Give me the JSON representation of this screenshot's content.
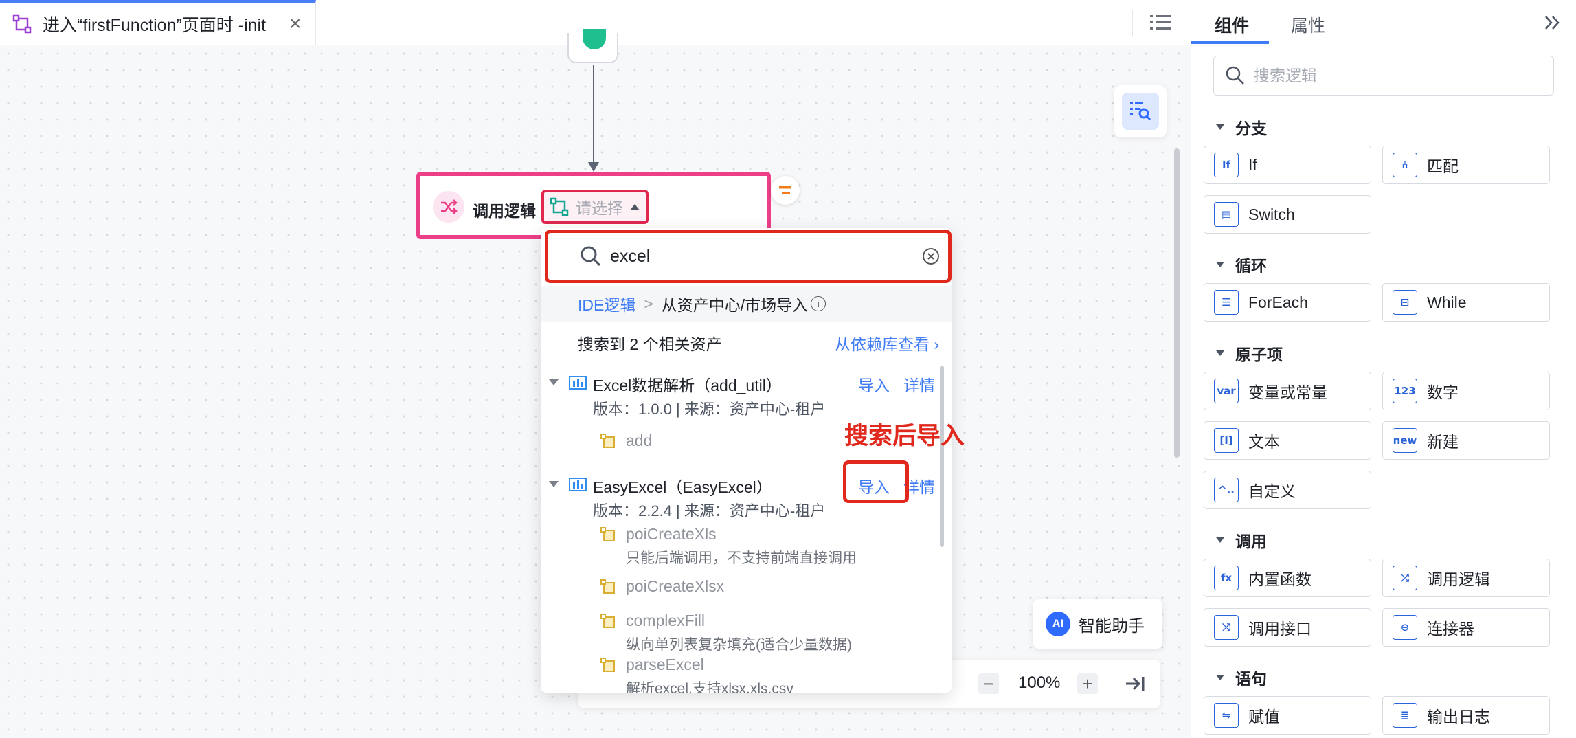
{
  "tab": {
    "title": "进入“firstFunction”页面时 -init",
    "close": "×"
  },
  "node": {
    "title": "调用逻辑",
    "select_placeholder": "请选择"
  },
  "dropdown": {
    "search_value": "excel",
    "breadcrumb": {
      "root": "IDE逻辑",
      "separator": ">",
      "current": "从资产中心/市场导入"
    },
    "result_count": "搜索到 2 个相关资产",
    "from_dependency": "从依赖库查看 ›",
    "assets": [
      {
        "name": "Excel数据解析（add_util）",
        "import": "导入",
        "detail": "详情",
        "meta": "版本：1.0.0  |  来源：资产中心-租户",
        "functions": [
          {
            "name": "add",
            "desc": ""
          }
        ]
      },
      {
        "name": "EasyExcel（EasyExcel）",
        "import": "导入",
        "detail": "详情",
        "meta": "版本：2.2.4  |  来源：资产中心-租户",
        "functions": [
          {
            "name": "poiCreateXls",
            "desc": "只能后端调用，不支持前端直接调用"
          },
          {
            "name": "poiCreateXlsx",
            "desc": ""
          },
          {
            "name": "complexFill",
            "desc": "纵向单列表复杂填充(适合少量数据)"
          },
          {
            "name": "parseExcel",
            "desc": "解析excel,支持xlsx,xls,csv"
          }
        ]
      }
    ]
  },
  "annotation": "搜索后导入",
  "toolbar": {
    "zoom": "100%",
    "minus": "−",
    "plus": "+"
  },
  "ai_assistant": {
    "badge": "AI",
    "label": "智能助手"
  },
  "panel": {
    "tabs": [
      "组件",
      "属性"
    ],
    "search_placeholder": "搜索逻辑",
    "sections": [
      {
        "title": "分支",
        "items": [
          {
            "label": "If",
            "icon": "If"
          },
          {
            "label": "匹配",
            "icon": "⑃"
          },
          {
            "label": "Switch",
            "icon": "▤"
          }
        ]
      },
      {
        "title": "循环",
        "items": [
          {
            "label": "ForEach",
            "icon": "☰"
          },
          {
            "label": "While",
            "icon": "⊟"
          }
        ]
      },
      {
        "title": "原子项",
        "items": [
          {
            "label": "变量或常量",
            "icon": "var"
          },
          {
            "label": "数字",
            "icon": "123"
          },
          {
            "label": "文本",
            "icon": "[I]"
          },
          {
            "label": "新建",
            "icon": "new"
          },
          {
            "label": "自定义",
            "icon": "^.."
          }
        ]
      },
      {
        "title": "调用",
        "items": [
          {
            "label": "内置函数",
            "icon": "fx"
          },
          {
            "label": "调用逻辑",
            "icon": "⤮"
          },
          {
            "label": "调用接口",
            "icon": "⤮"
          },
          {
            "label": "连接器",
            "icon": "⊖"
          }
        ]
      },
      {
        "title": "语句",
        "items": [
          {
            "label": "赋值",
            "icon": "⇋"
          },
          {
            "label": "输出日志",
            "icon": "≣"
          }
        ]
      }
    ]
  },
  "colors": {
    "accent": "#3f7bf5",
    "highlight_red": "#e0281d",
    "node_border": "#ec3f87"
  }
}
